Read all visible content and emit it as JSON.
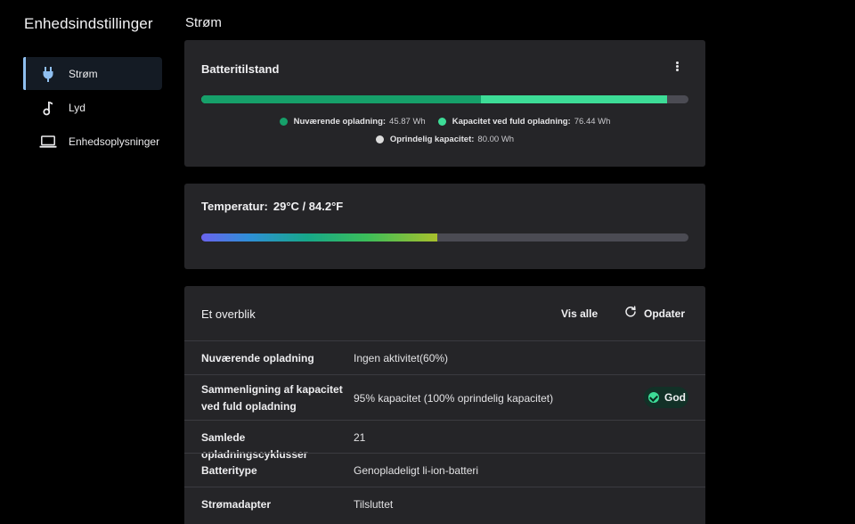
{
  "colors": {
    "accent": "#8fbfef",
    "current_charge": "#16a06a",
    "full_capacity": "#3ddc97",
    "original_capacity": "#dcdcdc",
    "track": "#4b4b53",
    "good": "#3ddc97"
  },
  "sidebar": {
    "title": "Enhedsindstillinger",
    "items": [
      {
        "label": "Strøm",
        "icon": "plug-icon",
        "active": true
      },
      {
        "label": "Lyd",
        "icon": "music-note-icon",
        "active": false
      },
      {
        "label": "Enhedsoplysninger",
        "icon": "laptop-icon",
        "active": false
      }
    ]
  },
  "page": {
    "title": "Strøm"
  },
  "battery_health": {
    "title": "Batteritilstand",
    "current_charge_fraction": 0.5733,
    "full_capacity_fraction": 0.9555,
    "legend": {
      "current_label": "Nuværende opladning:",
      "current_value": "45.87 Wh",
      "full_label": "Kapacitet ved fuld opladning:",
      "full_value": "76.44 Wh",
      "original_label": "Oprindelig kapacitet:",
      "original_value": "80.00 Wh"
    }
  },
  "temperature": {
    "label": "Temperatur:",
    "value": "29°C / 84.2°F",
    "level_fraction": 0.485
  },
  "overview": {
    "title": "Et overblik",
    "view_all": "Vis alle",
    "refresh": "Opdater",
    "rows": [
      {
        "key": "Nuværende opladning",
        "value": "Ingen aktivitet(60%)"
      },
      {
        "key": "Sammenligning af kapacitet ved fuld opladning",
        "value": "95% kapacitet (100% oprindelig kapacitet)",
        "badge": "God"
      },
      {
        "key": "Samlede opladningscyklusser",
        "value": "21"
      },
      {
        "key": "Batteritype",
        "value": "Genopladeligt li-ion-batteri"
      },
      {
        "key": "Strømadapter",
        "value": "Tilsluttet"
      }
    ]
  }
}
